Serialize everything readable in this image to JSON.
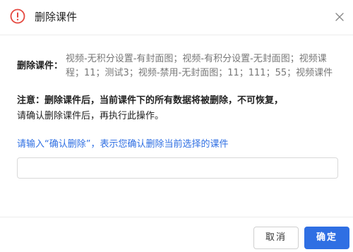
{
  "dialog": {
    "title": "删除课件",
    "courseware_label": "删除课件：",
    "courseware_list": "视频-无积分设置-有封面图；视频-有积分设置-无封面图；视频课程；11；测试3；视频-禁用-无封面图；11；111；55；视频课件",
    "notice_strong": "注意：删除课件后，当前课件下的所有数据将被删除，不可恢复，",
    "notice_text": "请确认删除课件后，再执行此操作。",
    "prompt": "请输入“确认删除”，表示您确认删除当前选择的课件",
    "input_value": "",
    "input_placeholder": ""
  },
  "buttons": {
    "cancel_label": "取消",
    "ok_label": "确定"
  },
  "icons": {
    "warning": "warning-circle-icon",
    "close": "close-icon"
  },
  "colors": {
    "warning": "#e5483f",
    "primary": "#2f6fe3",
    "muted_text": "#777777"
  }
}
